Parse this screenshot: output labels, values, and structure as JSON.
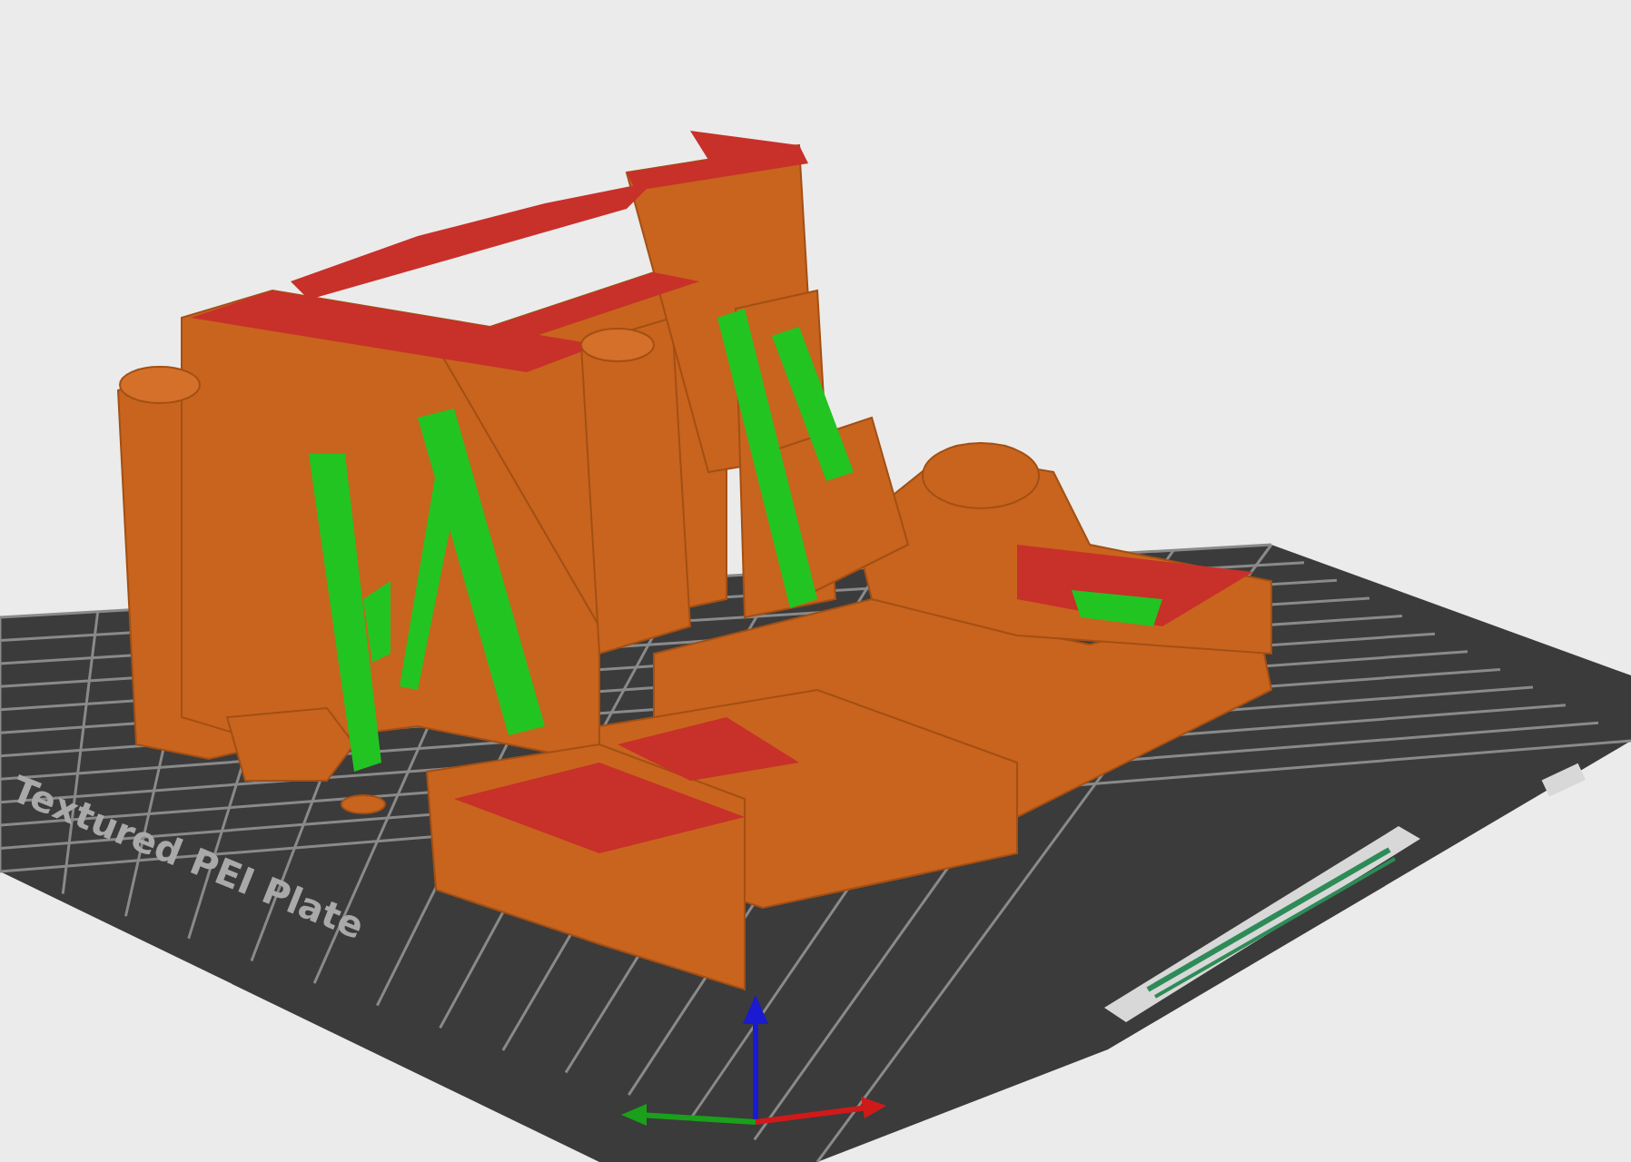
{
  "viewport": {
    "plate_label": "Textured PEI Plate"
  }
}
